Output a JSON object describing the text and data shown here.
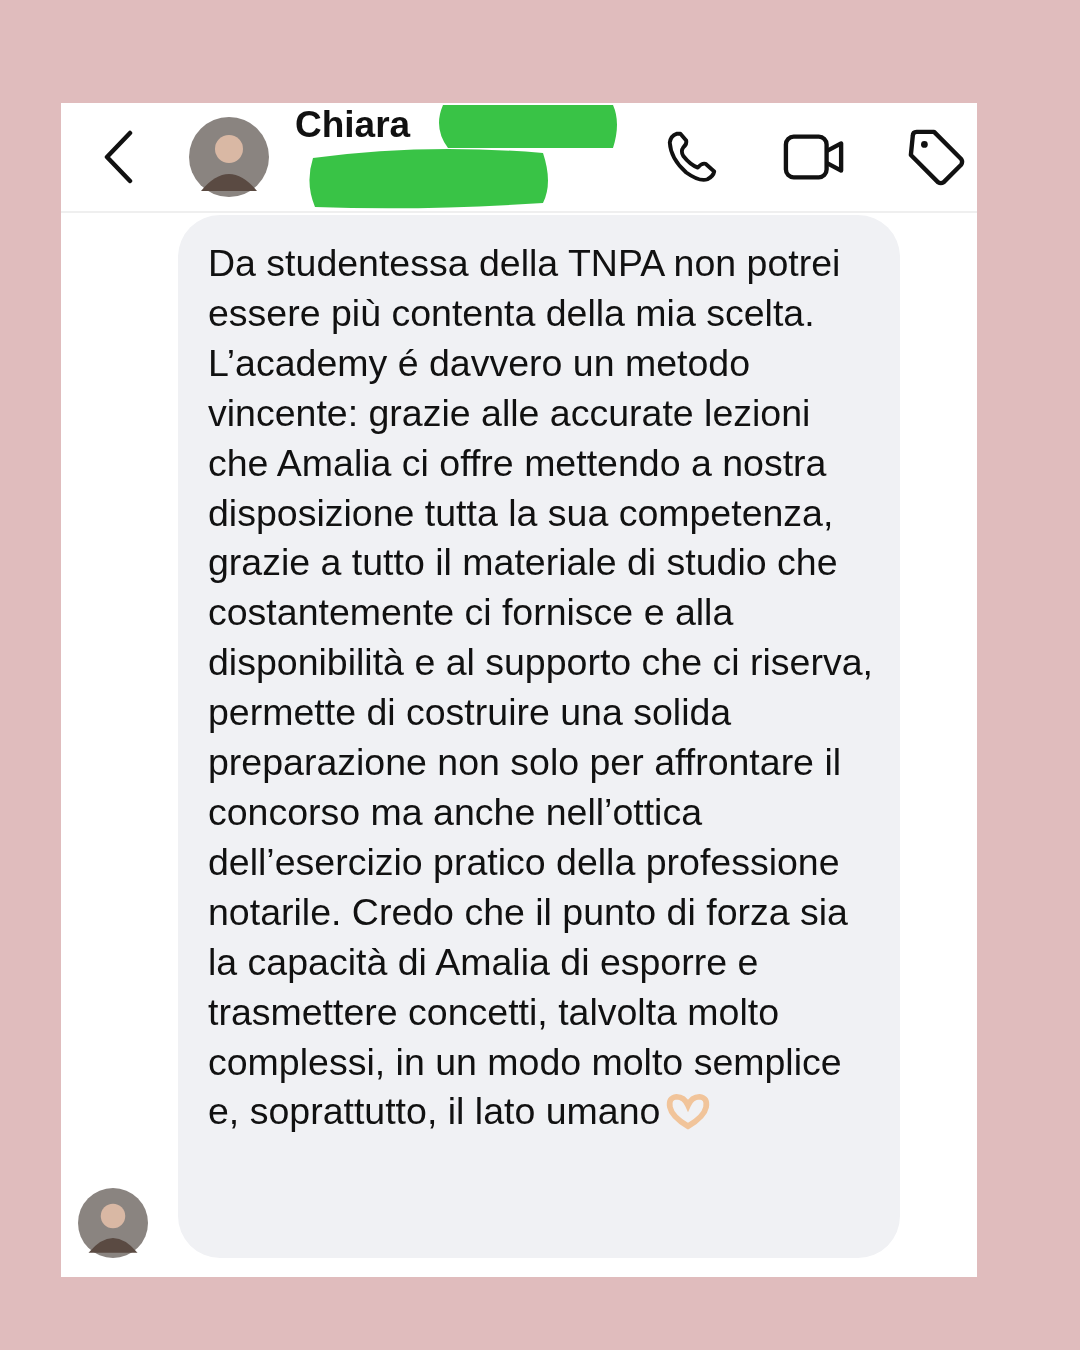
{
  "header": {
    "name": "Chiara",
    "redacted": true
  },
  "message": {
    "text": "Da studentessa della TNPA non potrei essere più contenta della mia scelta. L’academy é davvero un metodo vincente: grazie alle accurate lezioni che Amalia ci offre mettendo a nostra disposizione tutta la sua competenza, grazie a tutto il materiale di studio che costantemente ci fornisce e alla disponibilità e al supporto che ci riserva, permette di costruire una solida preparazione non solo per affrontare il concorso ma anche nell’ottica dell’esercizio pratico della professione notarile. Credo che il punto di forza sia la capacità di Amalia di esporre e trasmettere concetti, talvolta molto complessi, in un modo molto semplice e, soprattutto, il lato umano"
  }
}
